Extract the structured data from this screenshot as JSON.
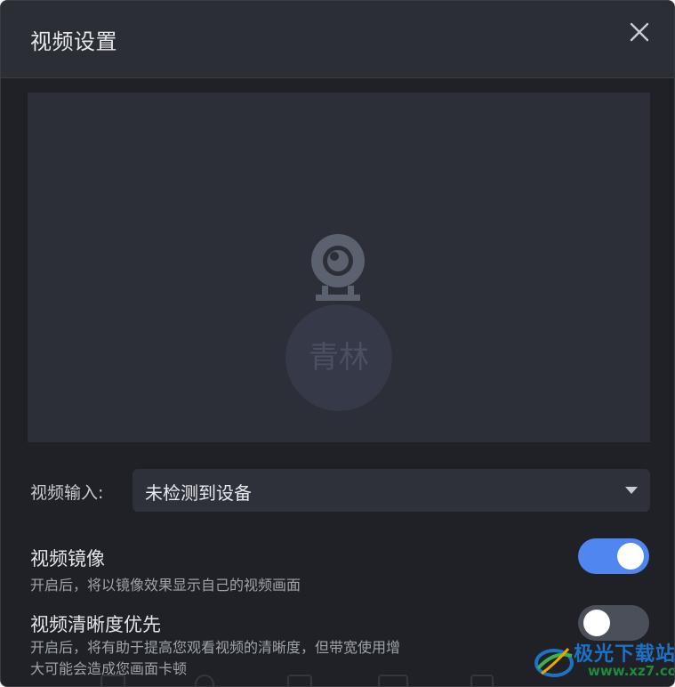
{
  "dialog": {
    "title": "视频设置",
    "close_icon": "close-icon"
  },
  "preview": {
    "avatar_text": "青林",
    "camera_icon": "webcam-icon"
  },
  "video_input": {
    "label": "视频输入:",
    "selected": "未检测到设备",
    "dropdown_icon": "chevron-down-icon"
  },
  "options": [
    {
      "title": "视频镜像",
      "description": "开启后，将以镜像效果显示自己的视频画面",
      "enabled": true
    },
    {
      "title": "视频清晰度优先",
      "description_line1": "开启后，将有助于提高您观看视频的清晰度，但带宽使用增",
      "description_line2": "大可能会造成您画面卡顿",
      "enabled": false
    }
  ],
  "watermark": {
    "brand": "极光下载站",
    "url": "www.xz7.com"
  },
  "colors": {
    "accent": "#4f86f0",
    "background": "#1f2127",
    "titlebar": "#2b2e34",
    "toggle_off": "#4b4f59"
  }
}
